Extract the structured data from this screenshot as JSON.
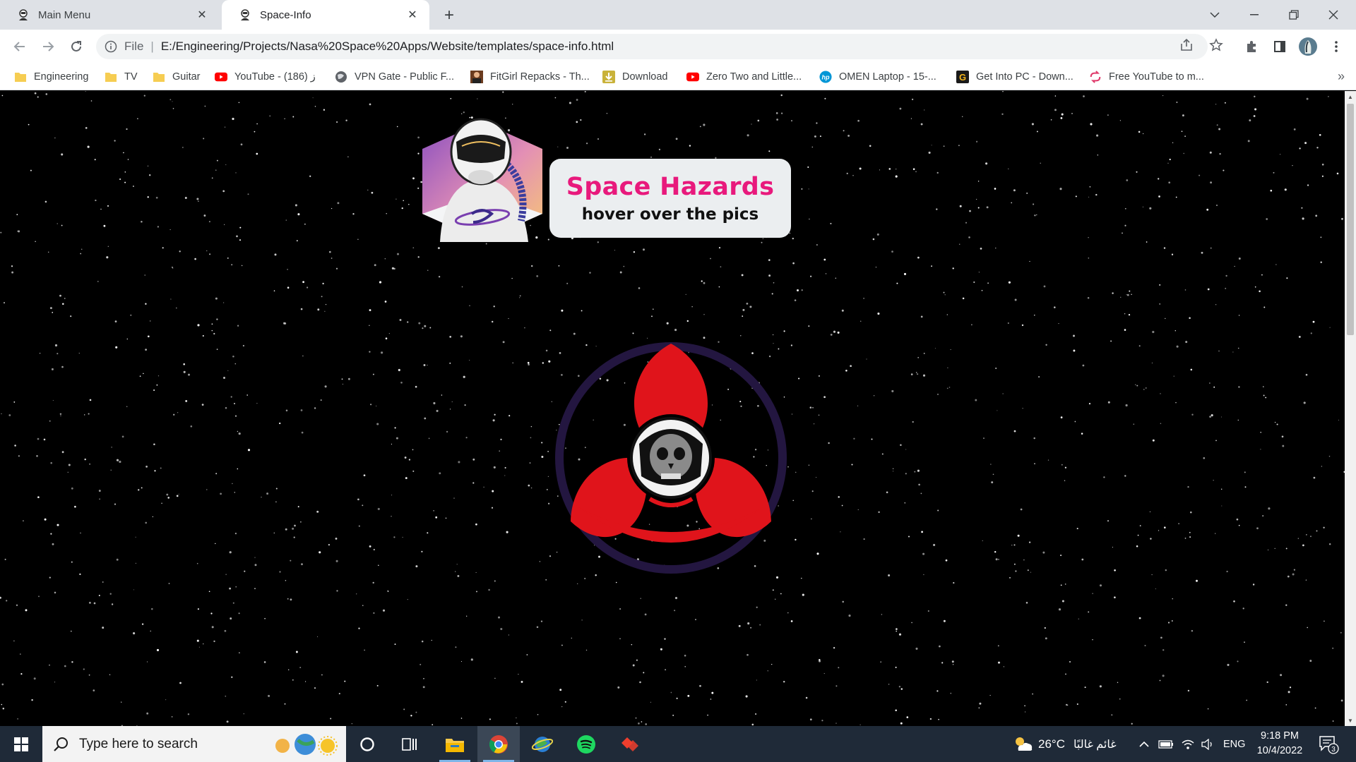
{
  "browser": {
    "tabs": [
      {
        "title": "Main Menu",
        "active": false,
        "icon": "astronaut-favicon"
      },
      {
        "title": "Space-Info",
        "active": true,
        "icon": "astronaut-favicon"
      }
    ],
    "new_tab_icon": "plus-icon",
    "window_controls": [
      "tab-search-chevron-icon",
      "minimize-icon",
      "restore-icon",
      "close-icon"
    ],
    "toolbar": {
      "back_icon": "back-arrow-icon",
      "forward_icon": "forward-arrow-icon",
      "reload_icon": "reload-icon",
      "address_scheme_label": "File",
      "address_url": "E:/Engineering/Projects/Nasa%20Space%20Apps/Website/templates/space-info.html",
      "right_icons": [
        "share-icon",
        "star-icon",
        "extensions-icon",
        "side-panel-icon",
        "profile-avatar",
        "kebab-menu-icon"
      ]
    },
    "bookmarks": [
      {
        "label": "Engineering",
        "icon": "folder-icon"
      },
      {
        "label": "TV",
        "icon": "folder-icon"
      },
      {
        "label": "Guitar",
        "icon": "folder-icon"
      },
      {
        "label": "YouTube - ز (186)",
        "icon": "youtube-icon"
      },
      {
        "label": "VPN Gate - Public F...",
        "icon": "globe-icon"
      },
      {
        "label": "FitGirl Repacks - Th...",
        "icon": "fitgirl-icon"
      },
      {
        "label": "Download",
        "icon": "download-icon"
      },
      {
        "label": "Zero Two and Little...",
        "icon": "youtube-icon"
      },
      {
        "label": "OMEN Laptop - 15-...",
        "icon": "hp-icon"
      },
      {
        "label": "Get Into PC - Down...",
        "icon": "getintopc-icon"
      },
      {
        "label": "Free YouTube to m...",
        "icon": "converter-icon"
      }
    ],
    "bookmarks_overflow": "»"
  },
  "page": {
    "title": "Space Hazards",
    "subtitle": "hover over the pics",
    "title_color": "#e8197c",
    "background": "#000000",
    "hero_image": "astronaut-hexagon-image",
    "hazard_image": "biohazard-skull-astronaut-image"
  },
  "taskbar": {
    "search_placeholder": "Type here to search",
    "apps": [
      "cortana-icon",
      "task-view-icon",
      "file-explorer-icon",
      "chrome-icon",
      "earth-app-icon",
      "spotify-icon",
      "anydesk-icon"
    ],
    "weather_temp": "26°C",
    "weather_text": "غائم غالبًا",
    "language": "ENG",
    "time": "9:18 PM",
    "date": "10/4/2022",
    "notification_count": "3"
  }
}
